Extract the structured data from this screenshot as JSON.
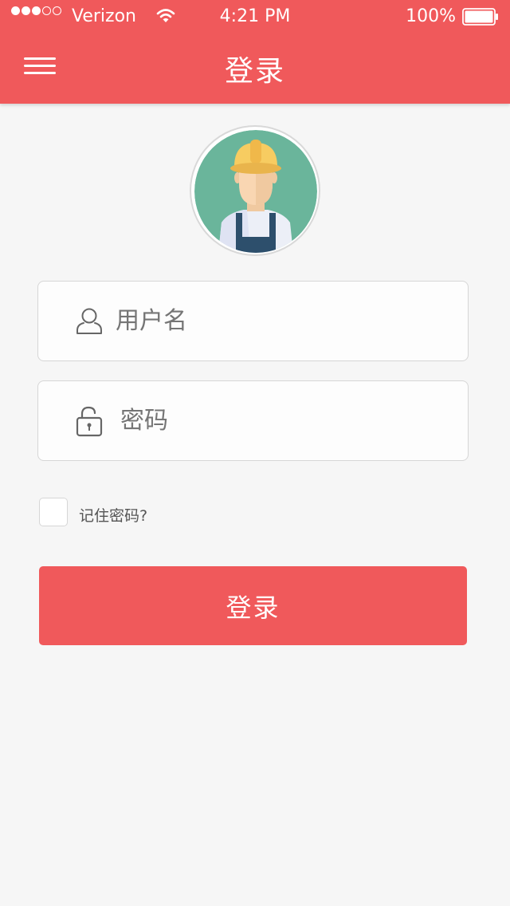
{
  "status_bar": {
    "carrier": "Verizon",
    "time": "4:21 PM",
    "battery": "100%",
    "signal_icon": "signal-dots-icon",
    "wifi_icon": "wifi-icon",
    "battery_icon": "battery-icon"
  },
  "navbar": {
    "title": "登录",
    "menu_icon": "hamburger-menu-icon"
  },
  "avatar": {
    "icon": "worker-avatar-icon"
  },
  "form": {
    "username_placeholder": "用户名",
    "username_icon": "user-icon",
    "password_placeholder": "密码",
    "password_icon": "lock-icon",
    "remember_label": "记住密码?",
    "remember_checked": false,
    "submit_label": "登录"
  },
  "colors": {
    "accent": "#f0595b",
    "background": "#f6f6f6",
    "avatar_bg": "#6ab59b"
  }
}
